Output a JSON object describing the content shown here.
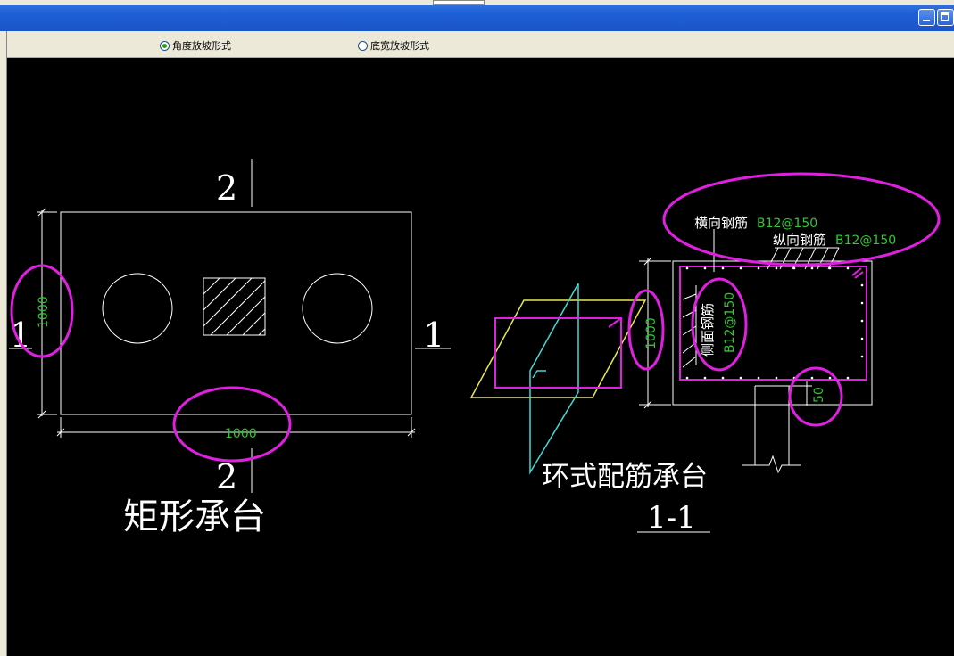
{
  "toolbar": {
    "options": [
      {
        "label": "角度放坡形式",
        "selected": true
      },
      {
        "label": "底宽放坡形式",
        "selected": false
      }
    ]
  },
  "drawing": {
    "rect_cap": {
      "section_mark_top": "2",
      "section_mark_bottom": "2",
      "section_mark_left": "1",
      "section_mark_right": "1",
      "dim_vertical": "1000",
      "dim_horizontal": "1000",
      "caption": "矩形承台"
    },
    "ring_cap": {
      "caption": "环式配筋承台",
      "section_label": "1-1",
      "dim_vertical": "1000",
      "cover_dim": "50",
      "transverse_rebar_label": "横向钢筋",
      "transverse_rebar_value": "B12@150",
      "longitudinal_rebar_label": "纵向钢筋",
      "longitudinal_rebar_value": "B12@150",
      "side_rebar_label": "侧面钢筋",
      "side_rebar_value": "B12@150"
    }
  },
  "colors": {
    "highlight": "#e020e0",
    "dimension_text": "#2fc82f",
    "outline": "#ffffff",
    "yellow_plane": "#e8e850",
    "cyan_plane": "#40d8d8"
  }
}
